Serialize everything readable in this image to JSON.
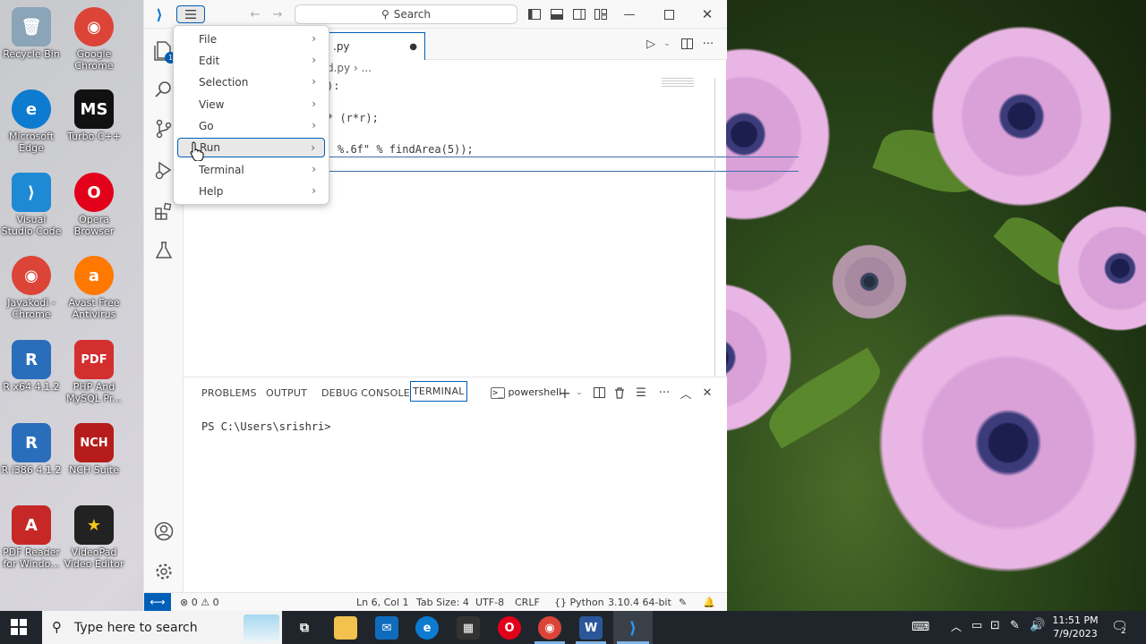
{
  "desktop": {
    "icons": [
      {
        "label": "Recycle Bin",
        "glyph": "🗑",
        "color": "#8aa4b8"
      },
      {
        "label": "Google Chrome",
        "glyph": "◉",
        "color": "#db4437"
      },
      {
        "label": "Microsoft Edge",
        "glyph": "e",
        "color": "#0c7bd0"
      },
      {
        "label": "Turbo C++",
        "glyph": "MS",
        "color": "#111111"
      },
      {
        "label": "Visual Studio Code",
        "glyph": "⟩",
        "color": "#1e8ad6"
      },
      {
        "label": "Opera Browser",
        "glyph": "O",
        "color": "#e2001a"
      },
      {
        "label": "Jayakodi - Chrome",
        "glyph": "◉",
        "color": "#db4437"
      },
      {
        "label": "Avast Free Antivirus",
        "glyph": "a",
        "color": "#ff7800"
      },
      {
        "label": "R x64 4.1.2",
        "glyph": "R",
        "color": "#2a6ebb"
      },
      {
        "label": "PHP And MySQL Pr...",
        "glyph": "PDF",
        "color": "#d32f2f"
      },
      {
        "label": "R i386 4.1.2",
        "glyph": "R",
        "color": "#2a6ebb"
      },
      {
        "label": "NCH Suite",
        "glyph": "NCH",
        "color": "#b71c1c"
      },
      {
        "label": "PDF Reader for Windo...",
        "glyph": "A",
        "color": "#c62828"
      },
      {
        "label": "VideoPad Video Editor",
        "glyph": "★",
        "color": "#222222"
      }
    ]
  },
  "titlebar": {
    "search_label": "Search"
  },
  "tabs": {
    "active_label": ".py"
  },
  "breadcrumb": "d.py  ›  ...",
  "code_lines": [
    "):",
    "",
    "* (r*r);",
    "",
    "%.6f\" % findArea(5));"
  ],
  "menu": {
    "items": [
      {
        "label": "File"
      },
      {
        "label": "Edit"
      },
      {
        "label": "Selection"
      },
      {
        "label": "View"
      },
      {
        "label": "Go"
      },
      {
        "label": "Run"
      },
      {
        "label": "Terminal"
      },
      {
        "label": "Help"
      }
    ],
    "highlighted": "Run"
  },
  "panel": {
    "tabs": [
      "PROBLEMS",
      "OUTPUT",
      "DEBUG CONSOLE",
      "TERMINAL"
    ],
    "active_tab": "TERMINAL",
    "shell_label": "powershell",
    "terminal_prompt": "PS C:\\Users\\srishri>"
  },
  "statusbar": {
    "errors": "0",
    "warnings": "0",
    "position": "Ln 6, Col 1",
    "tab_size": "Tab Size: 4",
    "encoding": "UTF-8",
    "eol": "CRLF",
    "language": "Python",
    "interpreter": "3.10.4 64-bit"
  },
  "taskbar": {
    "search_placeholder": "Type here to search",
    "time": "11:51 PM",
    "date": "7/9/2023",
    "notification_count": "2"
  },
  "colors": {
    "accent": "#005fb8",
    "vscode_blue": "#0078d4"
  }
}
